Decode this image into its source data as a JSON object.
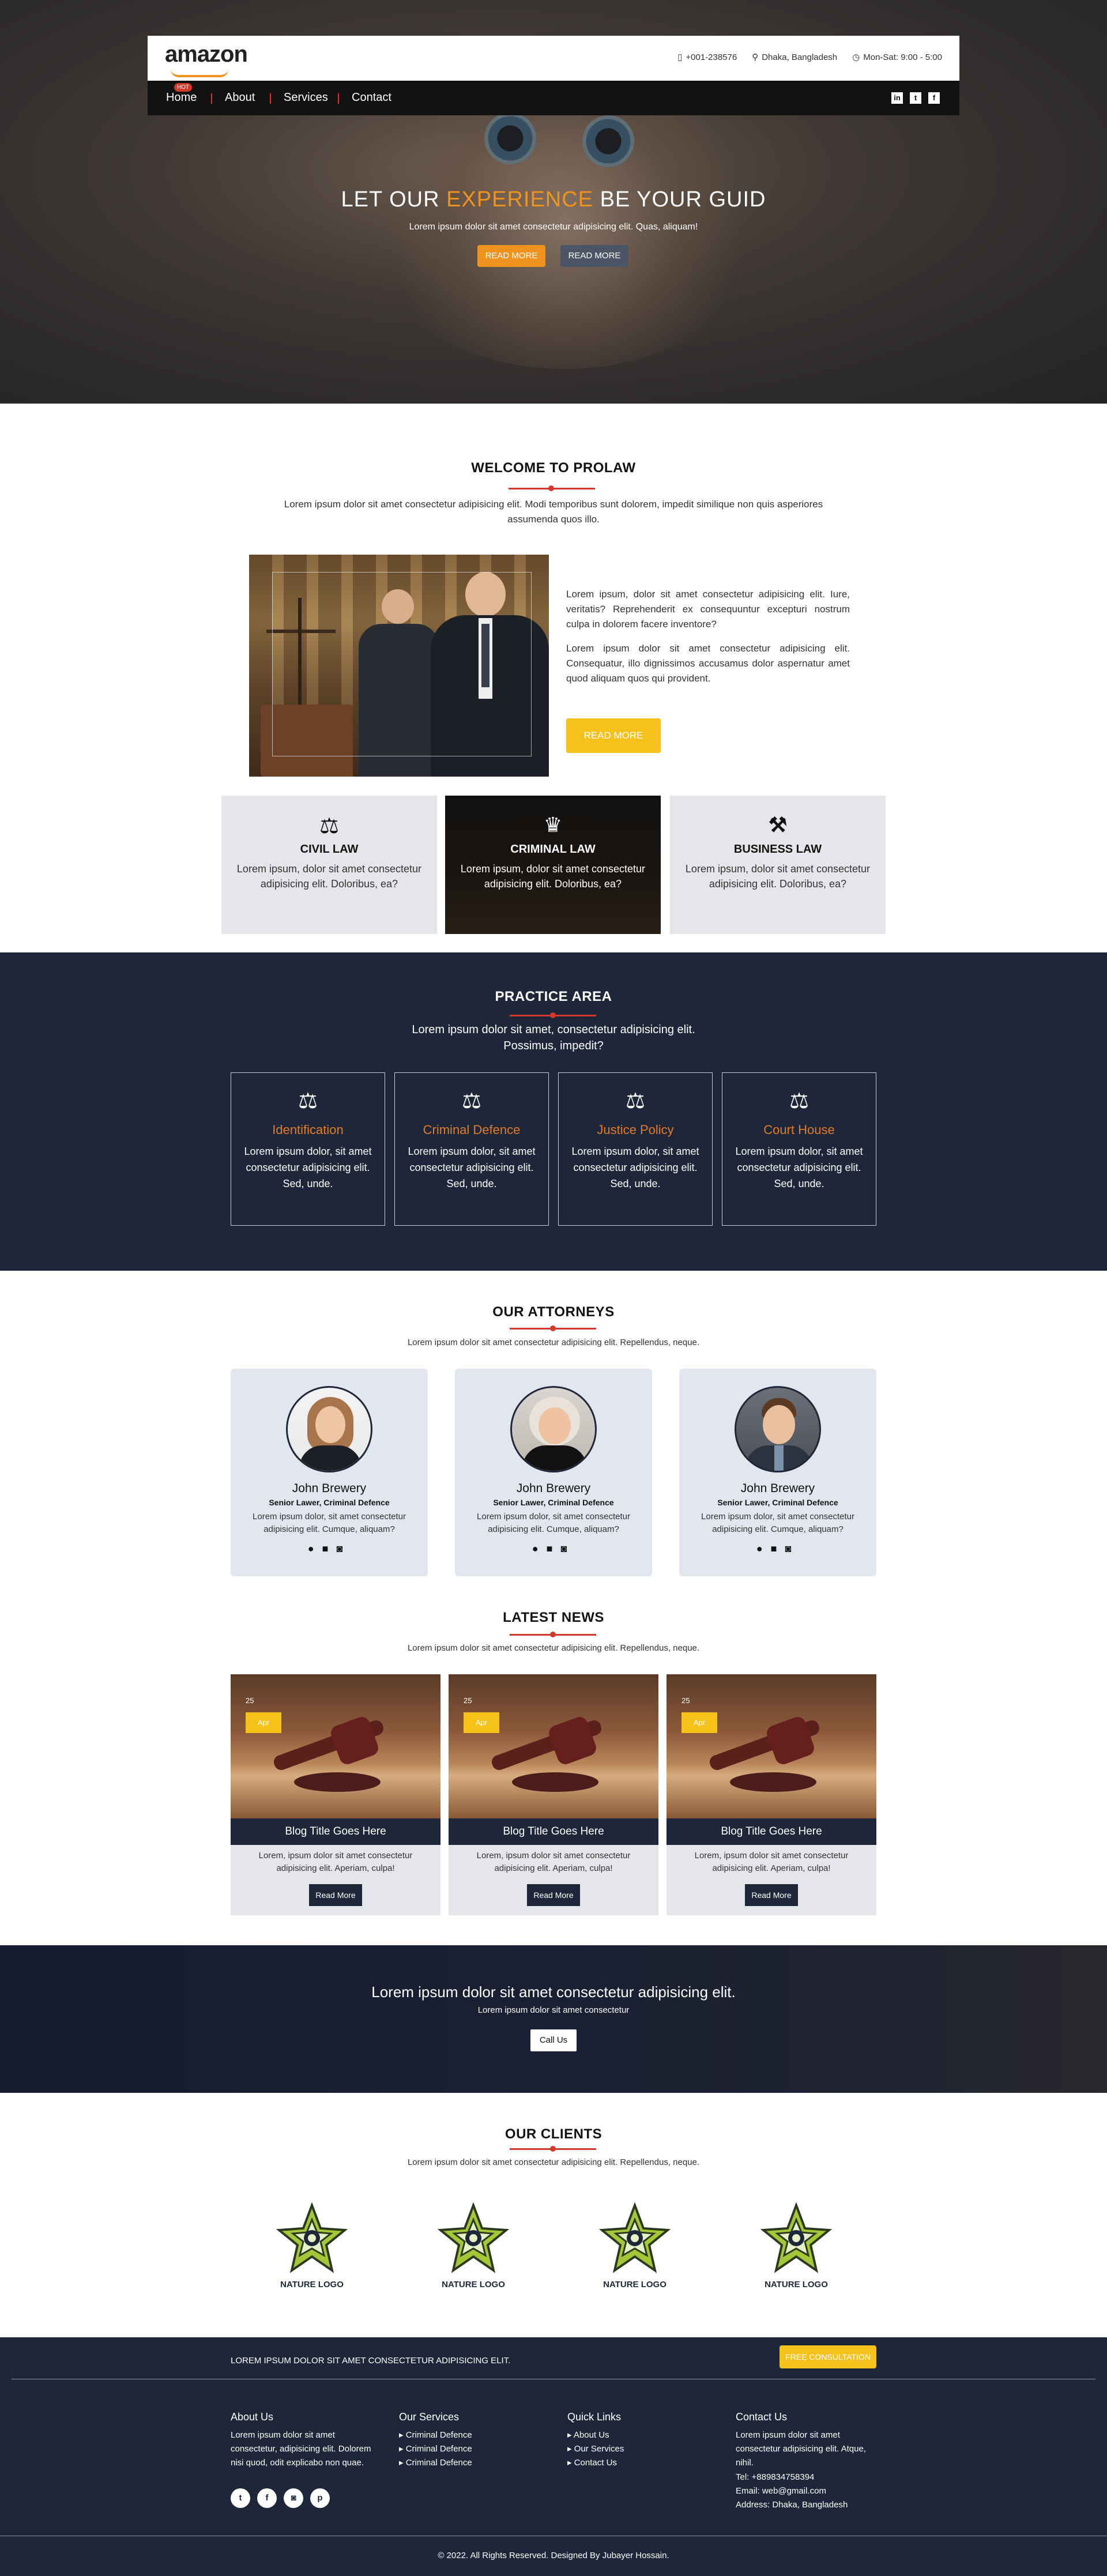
{
  "header": {
    "logo": "amazon",
    "phone": "+001-238576",
    "location": "Dhaka, Bangladesh",
    "hours": "Mon-Sat: 9:00 - 5:00",
    "nav": [
      "Home",
      "About",
      "Services",
      "Contact"
    ],
    "hot_badge": "HOT",
    "social_icons": [
      "linkedin-icon",
      "twitter-icon",
      "facebook-icon"
    ]
  },
  "hero": {
    "title_pre": "LET OUR ",
    "title_accent": "EXPERIENCE",
    "title_post": " BE YOUR GUID",
    "subtitle": "Lorem ipsum dolor sit amet consectetur adipisicing elit. Quas, aliquam!",
    "btn_primary": "READ MORE",
    "btn_secondary": "READ MORE",
    "colors": {
      "accent": "#f0921e",
      "secondary_btn": "#4b5566"
    }
  },
  "welcome": {
    "title": "WELCOME TO PROLAW",
    "intro": "Lorem ipsum dolor sit amet consectetur adipisicing elit. Modi temporibus sunt dolorem, impedit similique non quis asperiores assumenda quos illo.",
    "para1": "Lorem ipsum, dolor sit amet consectetur adipisicing elit. Iure, veritatis? Reprehenderit ex consequuntur excepturi nostrum culpa in dolorem facere inventore?",
    "para2": "Lorem ipsum dolor sit amet consectetur adipisicing elit. Consequatur, illo dignissimos accusamus dolor aspernatur amet quod aliquam quos qui provident.",
    "button": "READ MORE",
    "button_color": "#f6c21a"
  },
  "services": [
    {
      "icon": "scales-icon",
      "title": "CIVIL LAW",
      "text": "Lorem ipsum, dolor sit amet consectetur adipisicing elit. Doloribus, ea?"
    },
    {
      "icon": "crown-icon",
      "title": "CRIMINAL LAW",
      "text": "Lorem ipsum, dolor sit amet consectetur adipisicing elit. Doloribus, ea?"
    },
    {
      "icon": "gavel-icon",
      "title": "BUSINESS LAW",
      "text": "Lorem ipsum, dolor sit amet consectetur adipisicing elit. Doloribus, ea?"
    }
  ],
  "practice": {
    "title": "PRACTICE AREA",
    "intro": "Lorem ipsum dolor sit amet, consectetur adipisicing elit. Possimus, impedit?",
    "items": [
      {
        "title": "Identification",
        "text": "Lorem ipsum dolor, sit amet consectetur adipisicing elit. Sed, unde."
      },
      {
        "title": "Criminal Defence",
        "text": "Lorem ipsum dolor, sit amet consectetur adipisicing elit. Sed, unde."
      },
      {
        "title": "Justice Policy",
        "text": "Lorem ipsum dolor, sit amet consectetur adipisicing elit. Sed, unde."
      },
      {
        "title": "Court House",
        "text": "Lorem ipsum dolor, sit amet consectetur adipisicing elit. Sed, unde."
      }
    ],
    "accent": "#e07b2a"
  },
  "attorneys": {
    "title": "OUR ATTORNEYS",
    "intro": "Lorem ipsum dolor sit amet consectetur adipisicing elit. Repellendus, neque.",
    "people": [
      {
        "name": "John Brewery",
        "role": "Senior Lawer, Criminal Defence",
        "bio": "Lorem ipsum dolor, sit amet consectetur adipisicing elit. Cumque, aliquam?"
      },
      {
        "name": "John Brewery",
        "role": "Senior Lawer, Criminal Defence",
        "bio": "Lorem ipsum dolor, sit amet consectetur adipisicing elit. Cumque, aliquam?"
      },
      {
        "name": "John Brewery",
        "role": "Senior Lawer, Criminal Defence",
        "bio": "Lorem ipsum dolor, sit amet consectetur adipisicing elit. Cumque, aliquam?"
      }
    ]
  },
  "news": {
    "title": "LATEST NEWS",
    "intro": "Lorem ipsum dolor sit amet consectetur adipisicing elit. Repellendus, neque.",
    "posts": [
      {
        "day": "25",
        "month": "Apr",
        "title": "Blog Title Goes Here",
        "text": "Lorem, ipsum dolor sit amet consectetur adipisicing elit. Aperiam, culpa!",
        "button": "Read More"
      },
      {
        "day": "25",
        "month": "Apr",
        "title": "Blog Title Goes Here",
        "text": "Lorem, ipsum dolor sit amet consectetur adipisicing elit. Aperiam, culpa!",
        "button": "Read More"
      },
      {
        "day": "25",
        "month": "Apr",
        "title": "Blog Title Goes Here",
        "text": "Lorem, ipsum dolor sit amet consectetur adipisicing elit. Aperiam, culpa!",
        "button": "Read More"
      }
    ]
  },
  "cta": {
    "title": "Lorem ipsum dolor sit amet consectetur adipisicing elit.",
    "sub": "Lorem ipsum dolor sit amet consectetur",
    "button": "Call Us"
  },
  "clients": {
    "title": "OUR CLIENTS",
    "intro": "Lorem ipsum dolor sit amet consectetur adipisicing elit. Repellendus, neque.",
    "logos": [
      "NATURE LOGO",
      "NATURE LOGO",
      "NATURE LOGO",
      "NATURE LOGO"
    ]
  },
  "footer": {
    "banner_text": "LOREM IPSUM DOLOR SIT AMET CONSECTETUR ADIPISICING ELIT.",
    "banner_button": "FREE CONSULTATION",
    "about_title": "About Us",
    "about_text": "Lorem ipsum dolor sit amet consectetur, adipisicing elit. Dolorem nisi quod, odit explicabo non quae.",
    "services_title": "Our Services",
    "services_links": [
      "Criminal Defence",
      "Criminal Defence",
      "Criminal Defence"
    ],
    "quick_title": "Quick Links",
    "quick_links": [
      "About Us",
      "Our Services",
      "Contact Us"
    ],
    "contact_title": "Contact Us",
    "contact_text": "Lorem ipsum dolor sit amet consectetur adipisicing elit. Atque, nihil.",
    "tel": "Tel: +889834758394",
    "email": "Email: web@gmail.com",
    "address": "Address: Dhaka, Bangladesh",
    "social_icons": [
      "twitter-icon",
      "facebook-icon",
      "instagram-icon",
      "pinterest-icon"
    ],
    "copyright": "© 2022. All Rights Reserved. Designed By Jubayer Hossain."
  }
}
